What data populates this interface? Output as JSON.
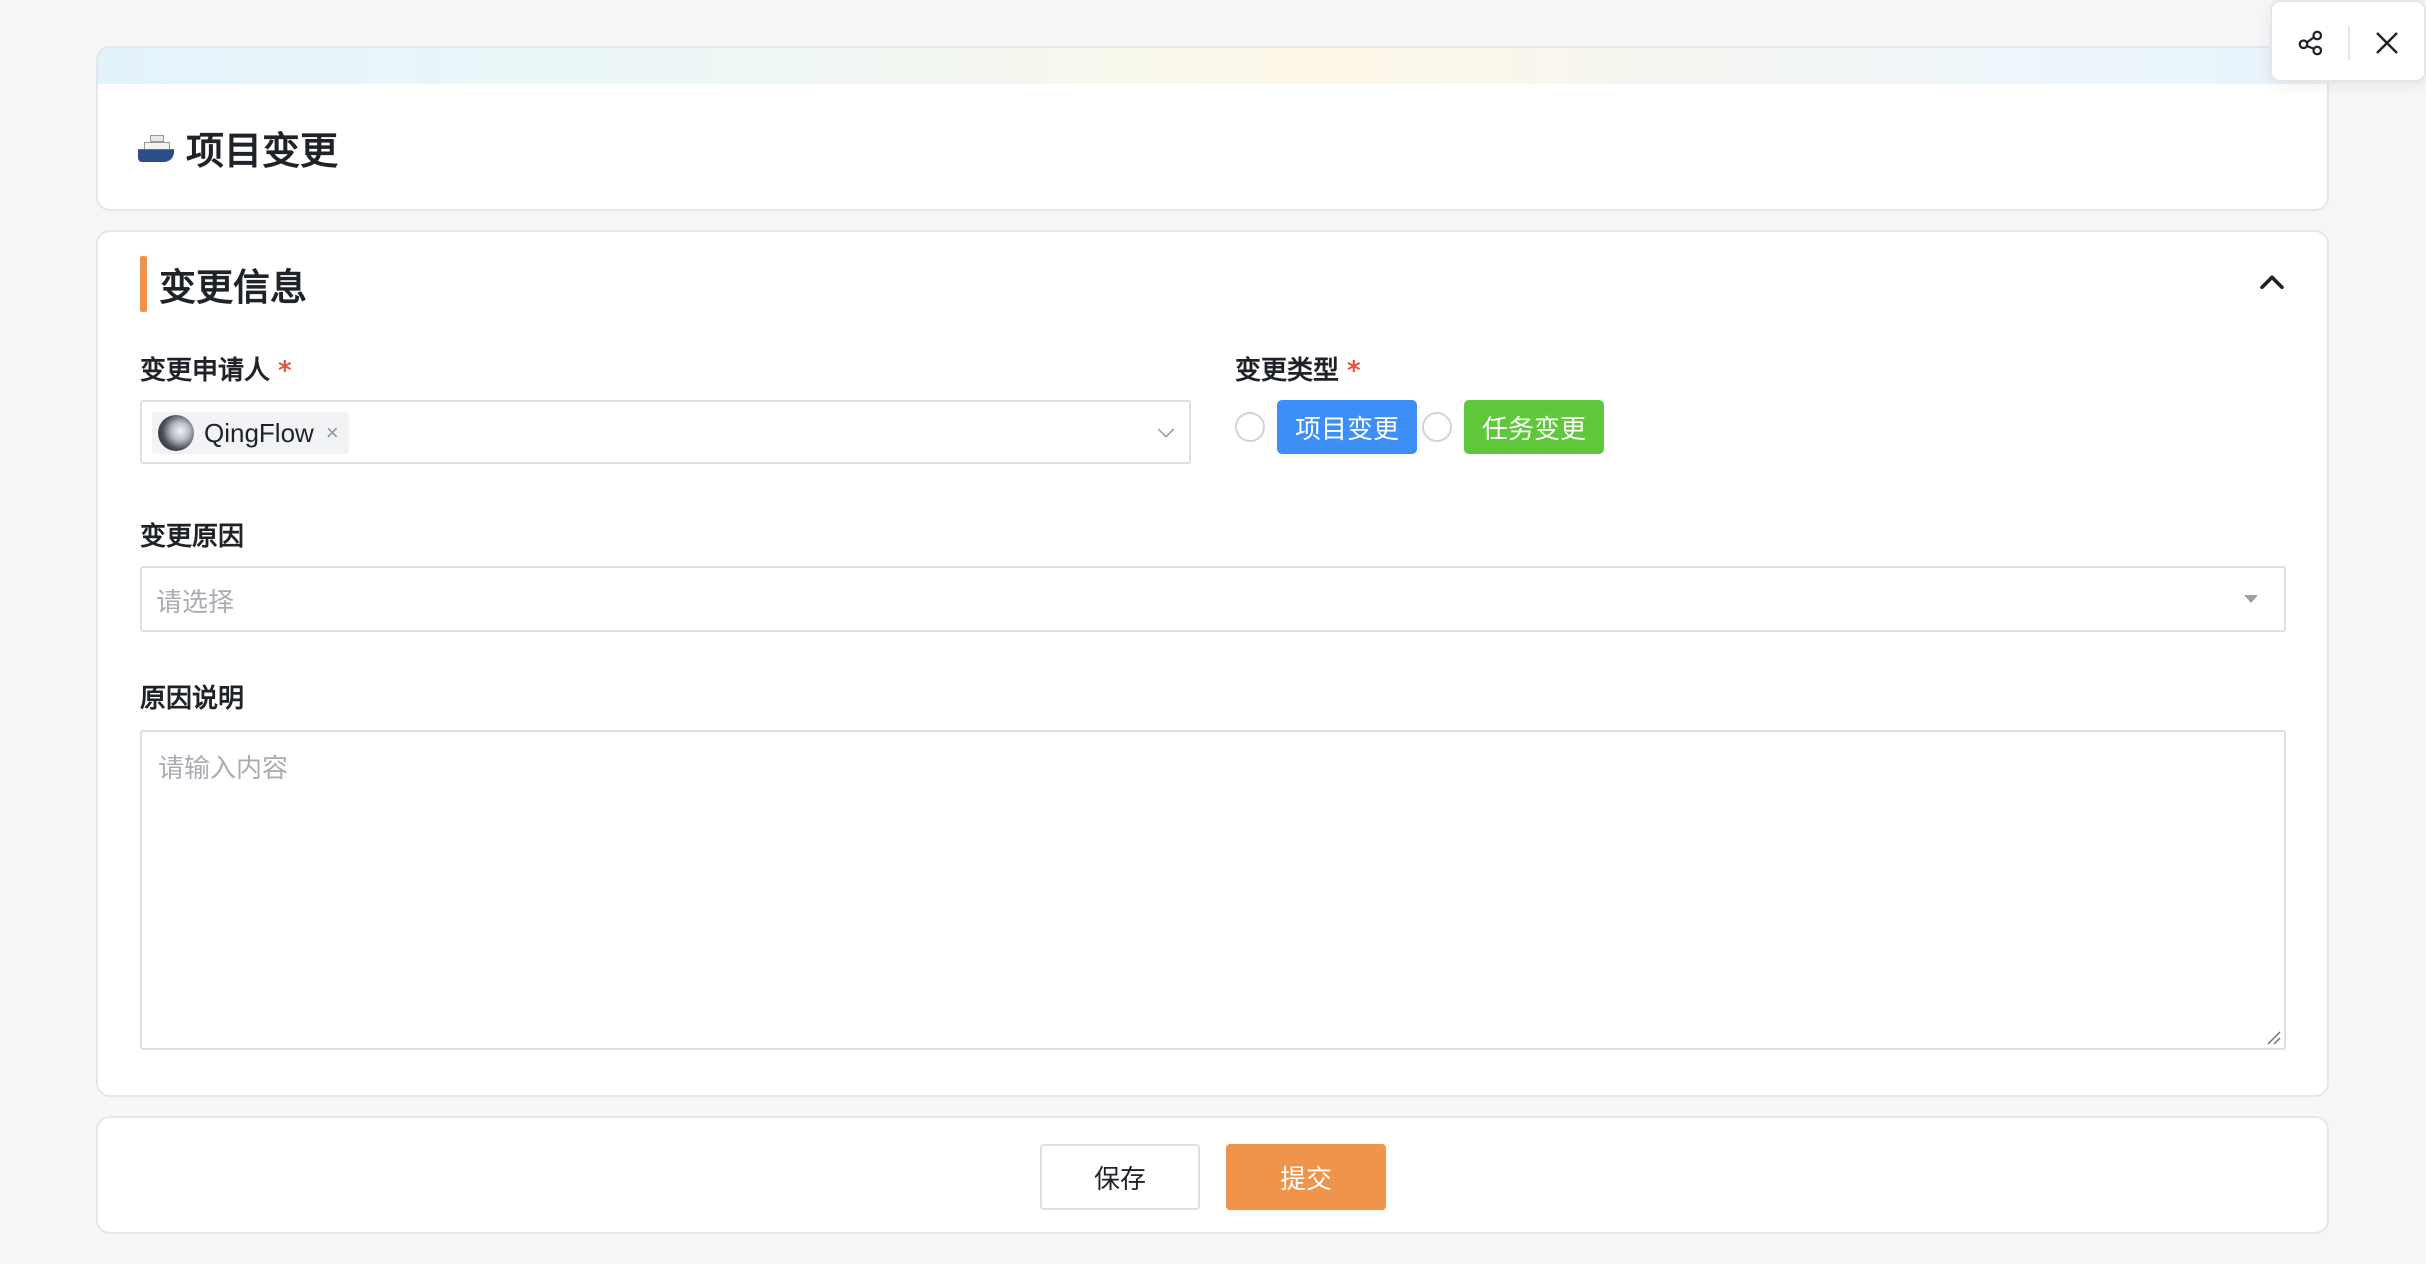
{
  "header": {
    "icon": "ship-icon",
    "title": "项目变更"
  },
  "toolbar": {
    "share_icon": "share-icon",
    "close_icon": "close-icon"
  },
  "section": {
    "title": "变更信息",
    "accent_color": "#f0944b",
    "collapse_icon": "chevron-up-icon"
  },
  "fields": {
    "applicant": {
      "label": "变更申请人",
      "required_mark": "*",
      "selected_user": "QingFlow",
      "remove_glyph": "×"
    },
    "change_type": {
      "label": "变更类型",
      "required_mark": "*",
      "options": [
        {
          "label": "项目变更",
          "color": "#3e8ef7"
        },
        {
          "label": "任务变更",
          "color": "#5ec73a"
        }
      ]
    },
    "reason": {
      "label": "变更原因",
      "placeholder": "请选择"
    },
    "reason_detail": {
      "label": "原因说明",
      "placeholder": "请输入内容"
    }
  },
  "footer": {
    "save_label": "保存",
    "submit_label": "提交",
    "submit_color": "#f0944b"
  }
}
